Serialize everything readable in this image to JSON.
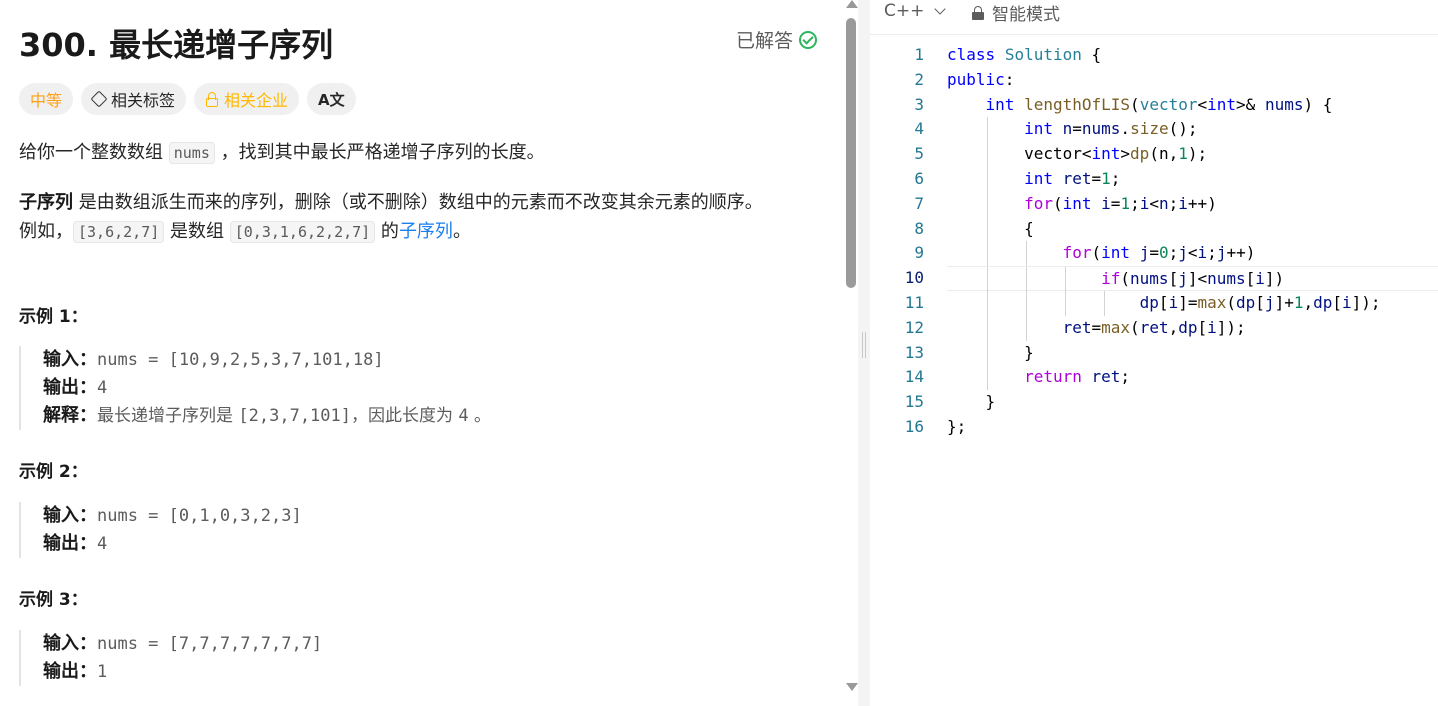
{
  "problem": {
    "title": "300. 最长递增子序列",
    "status": "已解答",
    "tags": {
      "difficulty": "中等",
      "related_tags": "相关标签",
      "related_companies": "相关企业",
      "font_icon": "A文"
    },
    "desc1_a": "给你一个整数数组 ",
    "desc1_code": "nums",
    "desc1_b": " ，找到其中最长严格递增子序列的长度。",
    "desc2_bold": "子序列",
    "desc2_a": " 是由数组派生而来的序列，删除（或不删除）数组中的元素而不改变其余元素的顺序。",
    "desc3_a": "例如，",
    "desc3_code1": "[3,6,2,7]",
    "desc3_b": " 是数组 ",
    "desc3_code2": "[0,3,1,6,2,2,7]",
    "desc3_c": " 的",
    "desc3_link": "子序列",
    "desc3_d": "。",
    "examples": [
      {
        "title": "示例 1：",
        "input_label": "输入：",
        "input": "nums = [10,9,2,5,3,7,101,18]",
        "output_label": "输出：",
        "output": "4",
        "explain_label": "解释：",
        "explain_a": "最长递增子序列是 ",
        "explain_code": "[2,3,7,101]",
        "explain_b": "，因此长度为 ",
        "explain_num": "4",
        "explain_c": " 。"
      },
      {
        "title": "示例 2：",
        "input_label": "输入：",
        "input": "nums = [0,1,0,3,2,3]",
        "output_label": "输出：",
        "output": "4"
      },
      {
        "title": "示例 3：",
        "input_label": "输入：",
        "input": "nums = [7,7,7,7,7,7,7]",
        "output_label": "输出：",
        "output": "1"
      }
    ]
  },
  "editor": {
    "language": "C++",
    "mode": "智能模式",
    "line_numbers": [
      "1",
      "2",
      "3",
      "4",
      "5",
      "6",
      "7",
      "8",
      "9",
      "10",
      "11",
      "12",
      "13",
      "14",
      "15",
      "16"
    ],
    "active_line": 10
  },
  "colors": {
    "accent_link": "#1a7ff0",
    "difficulty": "#ffa116",
    "solved": "#2db55d"
  }
}
